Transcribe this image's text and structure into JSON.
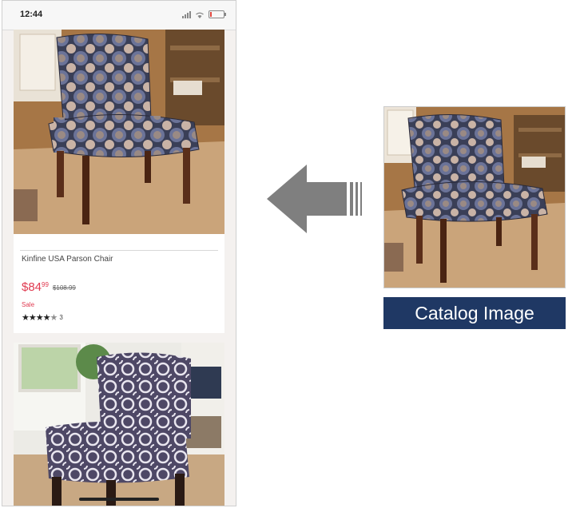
{
  "status_bar": {
    "time": "12:44",
    "icons": [
      "signal-icon",
      "wifi-icon",
      "battery-icon"
    ]
  },
  "product": {
    "name": "Kinfine USA Parson Chair",
    "price_dollars": "$84",
    "price_cents": "99",
    "original_price": "$108.99",
    "sale_label": "Sale",
    "rating_stars": 4.5,
    "rating_count": "3"
  },
  "arrow": {
    "direction": "left",
    "icon": "arrow-left-icon"
  },
  "catalog": {
    "label": "Catalog Image"
  },
  "colors": {
    "sale_red": "#e03a50",
    "catalog_label_bg": "#1f3864",
    "arrow_gray": "#7f7f7f"
  }
}
